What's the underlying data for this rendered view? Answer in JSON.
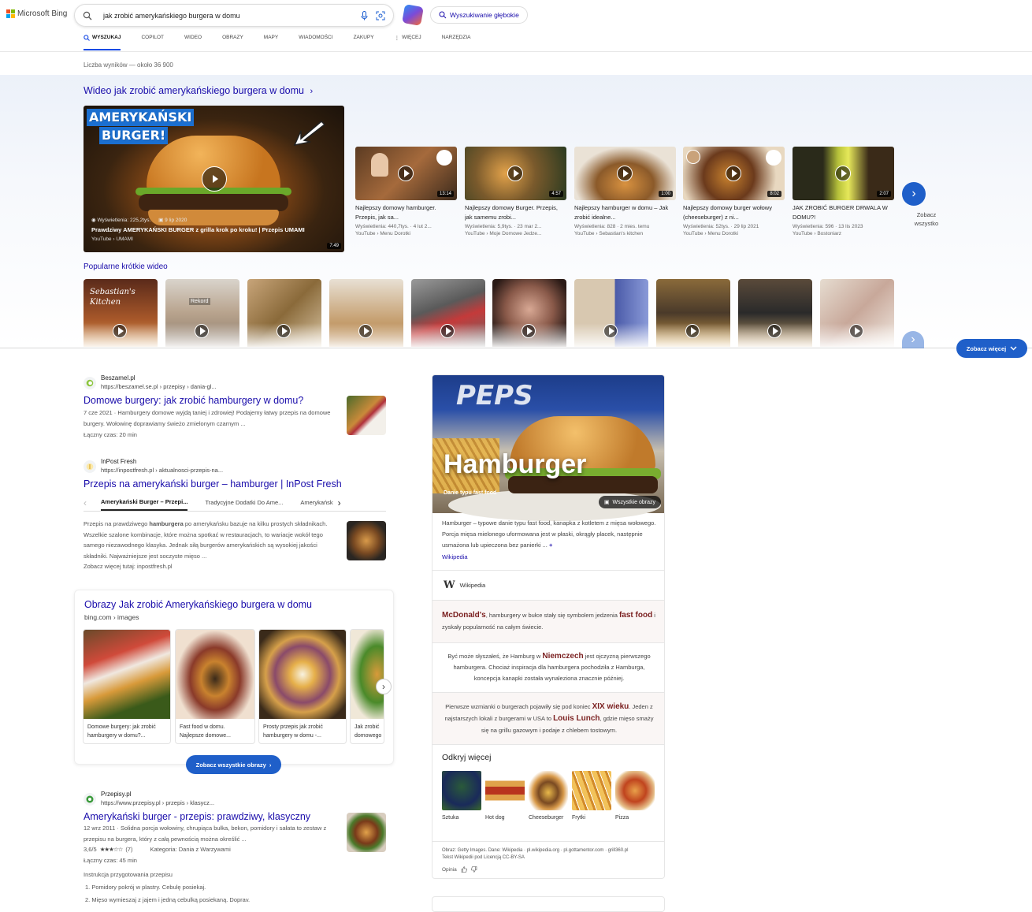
{
  "header": {
    "brand": "Microsoft Bing",
    "search_value": "jak zrobić amerykańskiego burgera w domu",
    "deep_search_label": "Wyszukiwanie głębokie",
    "tabs": [
      {
        "label": "WYSZUKAJ",
        "active": true
      },
      {
        "label": "COPILOT"
      },
      {
        "label": "WIDEO"
      },
      {
        "label": "OBRAZY"
      },
      {
        "label": "MAPY"
      },
      {
        "label": "WIADOMOŚCI"
      },
      {
        "label": "ZAKUPY"
      },
      {
        "label": "WIĘCEJ"
      },
      {
        "label": "NARZĘDZIA"
      }
    ]
  },
  "results_count": "Liczba wyników — około 36 900",
  "videos": {
    "title": "Wideo jak zrobić amerykańskiego burgera w domu",
    "featured": {
      "badge_line1": "AMERYKAŃSKI",
      "badge_line2": "BURGER!",
      "views": "Wyświetlenia: 225,2tys.",
      "date": "9 lip 2020",
      "caption": "Prawdziwy AMERYKAŃSKI BURGER z grilla krok po kroku! | Przepis UMAMI",
      "source": "YouTube › UMAMI",
      "duration": "7:49"
    },
    "cards": [
      {
        "title": "Najlepszy domowy hamburger. Przepis, jak sa...",
        "meta": "Wyświetlenia: 440,7tys. · 4 lut 2...",
        "source": "YouTube › Menu Dorotki",
        "duration": "13:14"
      },
      {
        "title": "Najlepszy domowy Burger. Przepis, jak samemu zrobi...",
        "meta": "Wyświetlenia: 5,9tys. · 23 mar 2...",
        "source": "YouTube › Moje Domowe Jedze...",
        "duration": "4:57"
      },
      {
        "title": "Najlepszy hamburger w domu – Jak zrobić idealne...",
        "meta": "Wyświetlenia: 828 · 2 mies. temu",
        "source": "YouTube › Sebastian's kitchen",
        "duration": "1:00"
      },
      {
        "title": "Najlepszy domowy burger wołowy (cheeseburger) z ni...",
        "meta": "Wyświetlenia: 52tys. · 29 lip 2021",
        "source": "YouTube › Menu Dorotki",
        "duration": "8:02"
      },
      {
        "title": "JAK ZROBIĆ BURGER DRWALA W DOMU?!",
        "meta": "Wyświetlenia: 596 · 13 lis 2023",
        "source": "YouTube › Bostoniarz",
        "duration": "2:07"
      }
    ],
    "see_all": "Zobacz wszystko",
    "shorts_title": "Popularne krótkie wideo",
    "short_overlays": [
      "Sebastian's Kitchen",
      "Rekord"
    ],
    "see_more": "Zobacz więcej"
  },
  "results": [
    {
      "site": "Beszamel.pl",
      "url": "https://beszamel.se.pl › przepisy › dania-gl...",
      "title": "Domowe burgery: jak zrobić hamburgery w domu?",
      "snippet": "7 cze 2021 · Hamburgery domowe wyjdą taniej i zdrowiej! Podajemy łatwy przepis na domowe burgery. Wołowinę doprawiamy świeżo zmielonym czarnym ...",
      "extra": "Łączny czas: 20 min"
    },
    {
      "site": "InPost Fresh",
      "url": "https://inpostfresh.pl › aktualnosci-przepis-na...",
      "title": "Przepis na amerykański burger – hamburger | InPost Fresh",
      "tabs": [
        "Amerykański Burger – Przepi...",
        "Tradycyjne Dodatki Do Ame...",
        "Amerykańsk"
      ],
      "snippet_pre": "Przepis na prawdziwego ",
      "snippet_bold": "hamburgera",
      "snippet_post": " po amerykańsku bazuje na kilku prostych składnikach. Wszelkie szalone kombinacje, które można spotkać w restauracjach, to wariacje wokół tego samego niezawodnego klasyka. Jednak siłą burgerów amerykańskich są wysokiej jakości składniki. Najważniejsze jest soczyste mięso ...",
      "link": "Zobacz więcej tutaj: inpostfresh.pl"
    },
    {
      "site": "Przepisy.pl",
      "url": "https://www.przepisy.pl › przepis › klasycz...",
      "title": "Amerykański burger - przepis: prawdziwy, klasyczny",
      "snippet": "12 wrz 2011 · Solidna porcja wołowiny, chrupiąca bułka, bekon, pomidory i sałata to zestaw z przepisu na burgera, który z całą pewnością można określić ...",
      "rating": "3,6/5",
      "rating_count": "(7)",
      "stars": 3.6,
      "category": "Kategoria: Dania z Warzywami",
      "time": "Łączny czas: 45 min",
      "instr_title": "Instrukcja przygotowania przepisu",
      "steps": [
        "1. Pomidory pokrój w plastry. Cebulę posiekaj.",
        "2. Mięso wymieszaj z jajem i jedną cebulką posiekaną. Doprav."
      ]
    }
  ],
  "images": {
    "title": "Obrazy Jak zrobić Amerykańskiego burgera w domu",
    "source": "bing.com › images",
    "items": [
      {
        "label": "Domowe burgery: jak zrobić hamburgery w domu?..."
      },
      {
        "label": "Fast food w domu. Najlepsze domowe..."
      },
      {
        "label": "Prosty przepis jak zrobić hamburgery w domu -..."
      },
      {
        "label": "Jak zrobić domowego"
      }
    ],
    "see_all": "Zobacz wszystkie obrazy"
  },
  "knowledge": {
    "title": "Hamburger",
    "subtitle": "Danie typu fast food",
    "all_images": "Wszystkie obrazy",
    "hero_brand": "PEPS",
    "description": "Hamburger – typowe danie typu fast food, kanapka z kotletem z mięsa wołowego. Porcja mięsa mielonego uformowana jest w płaski, okrągły placek, następnie usmażona lub upieczona bez panierki ...",
    "expand": "+",
    "wiki_link": "Wikipedia",
    "wiki_label": "Wikipedia",
    "facts": [
      {
        "b1": "McDonald's",
        "t1": ", hamburgery w bułce stały się symbolem jedzenia ",
        "b2": "fast food",
        "t2": " i zyskały popularność na całym świecie."
      },
      {
        "t0": "Być może słyszałeś, że Hamburg w ",
        "b1": "Niemczech",
        "t1": " jest ojczyzną pierwszego hamburgera. Chociaż inspiracja dla hamburgera pochodziła z Hamburga, koncepcja kanapki została wynaleziona znacznie później."
      },
      {
        "t0": "Pierwsze wzmianki o burgerach pojawiły się pod koniec ",
        "b1": "XIX wieku",
        "t1": ". Jeden z najstarszych lokali z burgerami w USA to ",
        "b2": "Louis Lunch",
        "t2": ", gdzie mięso smaży się na grillu gazowym i podaje z chlebem tostowym."
      }
    ],
    "discover_title": "Odkryj więcej",
    "discover": [
      {
        "label": "Sztuka"
      },
      {
        "label": "Hot dog"
      },
      {
        "label": "Cheeseburger"
      },
      {
        "label": "Frytki"
      },
      {
        "label": "Pizza"
      }
    ],
    "credits": "Obraz: Getty Images. Dane: Wikipedia · pl.wikipedia.org · pl.gottamentor.com · grill360.pl",
    "license": "Tekst Wikipedii pod Licencją CC-BY-SA",
    "feedback": "Opinia"
  },
  "colors": {
    "accent": "#1f5fc9",
    "link": "#1a0dab",
    "fact_bold": "#7a1f1f"
  }
}
